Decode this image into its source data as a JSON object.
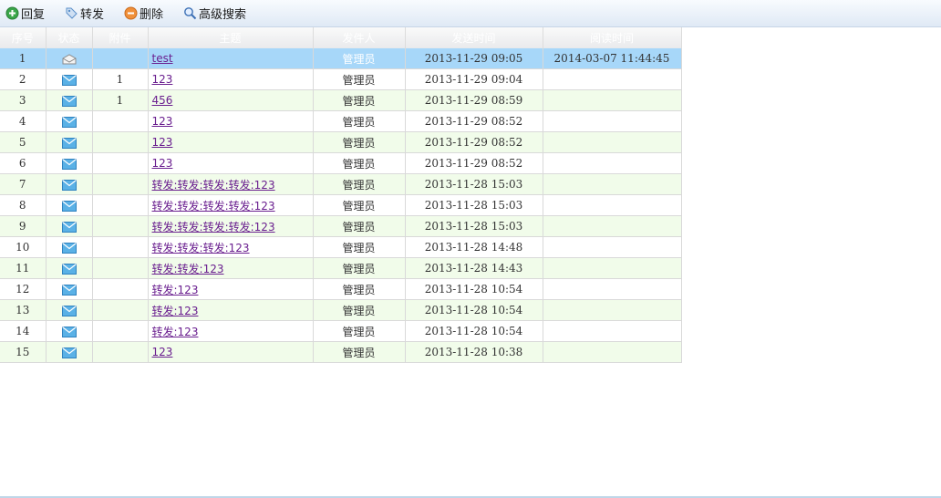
{
  "toolbar": {
    "buttons": [
      {
        "label": "回复",
        "icon": "plus-circle-icon",
        "color": "#3aa64a"
      },
      {
        "label": "转发",
        "icon": "tag-icon",
        "color": "#5a8fc9"
      },
      {
        "label": "删除",
        "icon": "minus-circle-icon",
        "color": "#e07a2a"
      },
      {
        "label": "高级搜索",
        "icon": "magnifier-icon",
        "color": "#3b6fb5"
      }
    ]
  },
  "table": {
    "columns": [
      "序号",
      "状态",
      "附件",
      "主题",
      "发件人",
      "发送时间",
      "阅读时间"
    ],
    "rows": [
      {
        "num": "1",
        "status": "read",
        "attachment": "",
        "subject": "test",
        "sender": "管理员",
        "sent": "2013-11-29 09:05",
        "read_time": "2014-03-07 11:44:45"
      },
      {
        "num": "2",
        "status": "unread",
        "attachment": "1",
        "subject": "123",
        "sender": "管理员",
        "sent": "2013-11-29 09:04",
        "read_time": ""
      },
      {
        "num": "3",
        "status": "unread",
        "attachment": "1",
        "subject": "456",
        "sender": "管理员",
        "sent": "2013-11-29 08:59",
        "read_time": ""
      },
      {
        "num": "4",
        "status": "unread",
        "attachment": "",
        "subject": "123",
        "sender": "管理员",
        "sent": "2013-11-29 08:52",
        "read_time": ""
      },
      {
        "num": "5",
        "status": "unread",
        "attachment": "",
        "subject": "123",
        "sender": "管理员",
        "sent": "2013-11-29 08:52",
        "read_time": ""
      },
      {
        "num": "6",
        "status": "unread",
        "attachment": "",
        "subject": "123",
        "sender": "管理员",
        "sent": "2013-11-29 08:52",
        "read_time": ""
      },
      {
        "num": "7",
        "status": "unread",
        "attachment": "",
        "subject": "转发:转发:转发:转发:123",
        "sender": "管理员",
        "sent": "2013-11-28 15:03",
        "read_time": ""
      },
      {
        "num": "8",
        "status": "unread",
        "attachment": "",
        "subject": "转发:转发:转发:转发:123",
        "sender": "管理员",
        "sent": "2013-11-28 15:03",
        "read_time": ""
      },
      {
        "num": "9",
        "status": "unread",
        "attachment": "",
        "subject": "转发:转发:转发:转发:123",
        "sender": "管理员",
        "sent": "2013-11-28 15:03",
        "read_time": ""
      },
      {
        "num": "10",
        "status": "unread",
        "attachment": "",
        "subject": "转发:转发:转发:123",
        "sender": "管理员",
        "sent": "2013-11-28 14:48",
        "read_time": ""
      },
      {
        "num": "11",
        "status": "unread",
        "attachment": "",
        "subject": "转发:转发:123",
        "sender": "管理员",
        "sent": "2013-11-28 14:43",
        "read_time": ""
      },
      {
        "num": "12",
        "status": "unread",
        "attachment": "",
        "subject": "转发:123",
        "sender": "管理员",
        "sent": "2013-11-28 10:54",
        "read_time": ""
      },
      {
        "num": "13",
        "status": "unread",
        "attachment": "",
        "subject": "转发:123",
        "sender": "管理员",
        "sent": "2013-11-28 10:54",
        "read_time": ""
      },
      {
        "num": "14",
        "status": "unread",
        "attachment": "",
        "subject": "转发:123",
        "sender": "管理员",
        "sent": "2013-11-28 10:54",
        "read_time": ""
      },
      {
        "num": "15",
        "status": "unread",
        "attachment": "",
        "subject": "123",
        "sender": "管理员",
        "sent": "2013-11-28 10:38",
        "read_time": ""
      }
    ]
  }
}
